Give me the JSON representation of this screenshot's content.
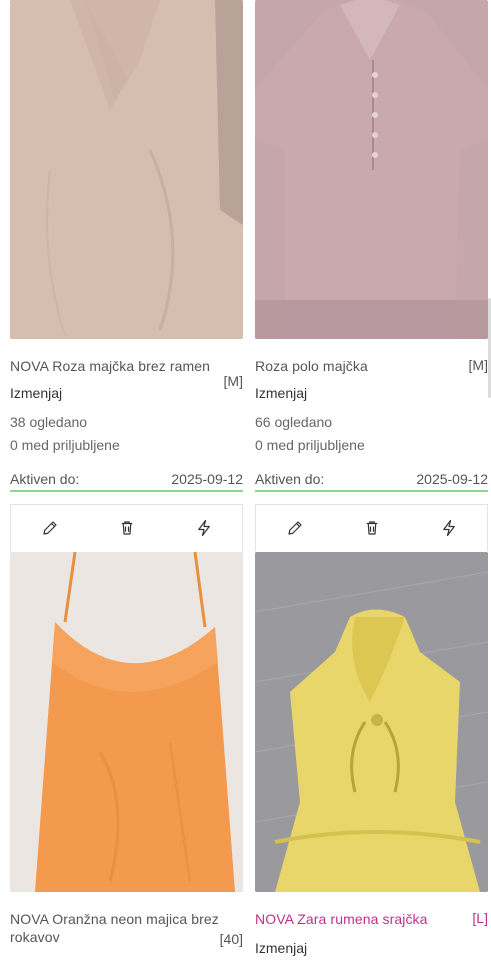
{
  "listings": [
    {
      "title": "NOVA Roza majčka brez ramen",
      "size": "[M]",
      "status": "Izmenjaj",
      "views": "38 ogledano",
      "favorites": "0 med priljubljene",
      "active_label": "Aktiven do:",
      "active_date": "2025-09-12",
      "image": "beige-top-photo"
    },
    {
      "title": "Roza polo majčka",
      "size": "[M]",
      "status": "Izmenjaj",
      "views": "66 ogledano",
      "favorites": "0 med priljubljene",
      "active_label": "Aktiven do:",
      "active_date": "2025-09-12",
      "image": "pink-polo-photo"
    },
    {
      "title": "NOVA Oranžna neon majica brez rokavov",
      "size": "[40]",
      "image": "orange-camisole-photo"
    },
    {
      "title": "NOVA Zara rumena srajčka",
      "size": "[L]",
      "status": "Izmenjaj",
      "image": "yellow-blouse-photo"
    }
  ],
  "toolbar_icons": [
    "pencil-icon",
    "trash-icon",
    "lightning-icon"
  ],
  "colors": {
    "active_underline": "#8fd694",
    "highlight_title": "#c0308a"
  }
}
